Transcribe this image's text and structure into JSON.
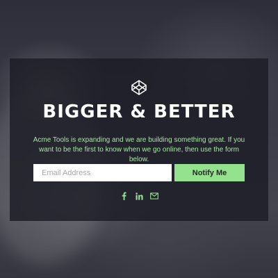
{
  "hero": {
    "logo_icon": "codepen-icon",
    "title": "BIGGER & BETTER",
    "description": "Acme Tools is expanding and we are building something great. If you want to be the first to know when we go online, then use the form below."
  },
  "form": {
    "email_placeholder": "Email Address",
    "email_value": "",
    "notify_label": "Notify Me"
  },
  "social": [
    {
      "icon": "facebook-icon"
    },
    {
      "icon": "linkedin-icon"
    },
    {
      "icon": "mail-icon"
    }
  ],
  "colors": {
    "accent": "#94e28e",
    "accent_text": "#a6e8a0",
    "panel": "#1c1c26",
    "title": "#ffffff"
  }
}
